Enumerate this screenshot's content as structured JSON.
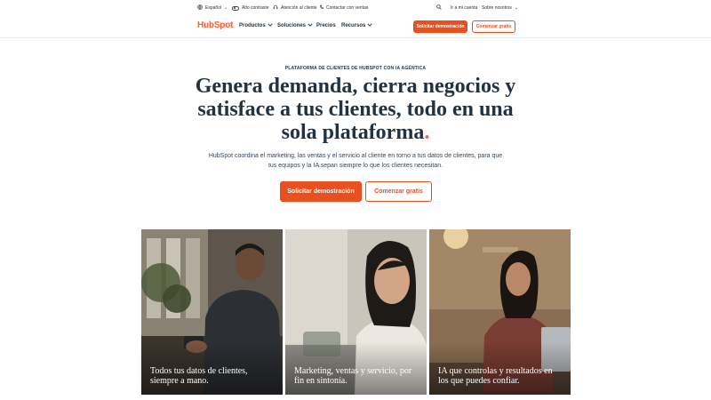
{
  "utility": {
    "language": "Español",
    "contrast": "Alto contraste",
    "support": "Atención al cliente",
    "sales": "Contactar con ventas",
    "account": "Ir a mi cuenta",
    "about": "Sobre nosotros"
  },
  "nav": {
    "logo": "HubSpot",
    "items": [
      "Productos",
      "Soluciones",
      "Precios",
      "Recursos"
    ],
    "demo_button": "Solicitar demostración",
    "free_button": "Comenzar gratis"
  },
  "hero": {
    "eyebrow": "PLATAFORMA DE CLIENTES DE HUBSPOT CON IA AGÉNTICA",
    "headline": "Genera demanda, cierra negocios y satisface a tus clientes, todo en una sola plataforma",
    "headline_end": ".",
    "subtext": "HubSpot coordina el marketing, las ventas y el servicio al cliente en torno a tus datos de clientes, para que tus equipos y la IA sepan siempre lo que los clientes necesitan.",
    "demo_button": "Solicitar demostración",
    "free_button": "Comenzar gratis"
  },
  "cards": [
    {
      "caption": "Todos tus datos de clientes, siempre a mano."
    },
    {
      "caption": "Marketing, ventas y servicio, por fin en sintonía."
    },
    {
      "caption": "IA que controlas y resultados en los que puedes confiar."
    }
  ],
  "colors": {
    "accent": "#e8511f",
    "text": "#213343"
  }
}
